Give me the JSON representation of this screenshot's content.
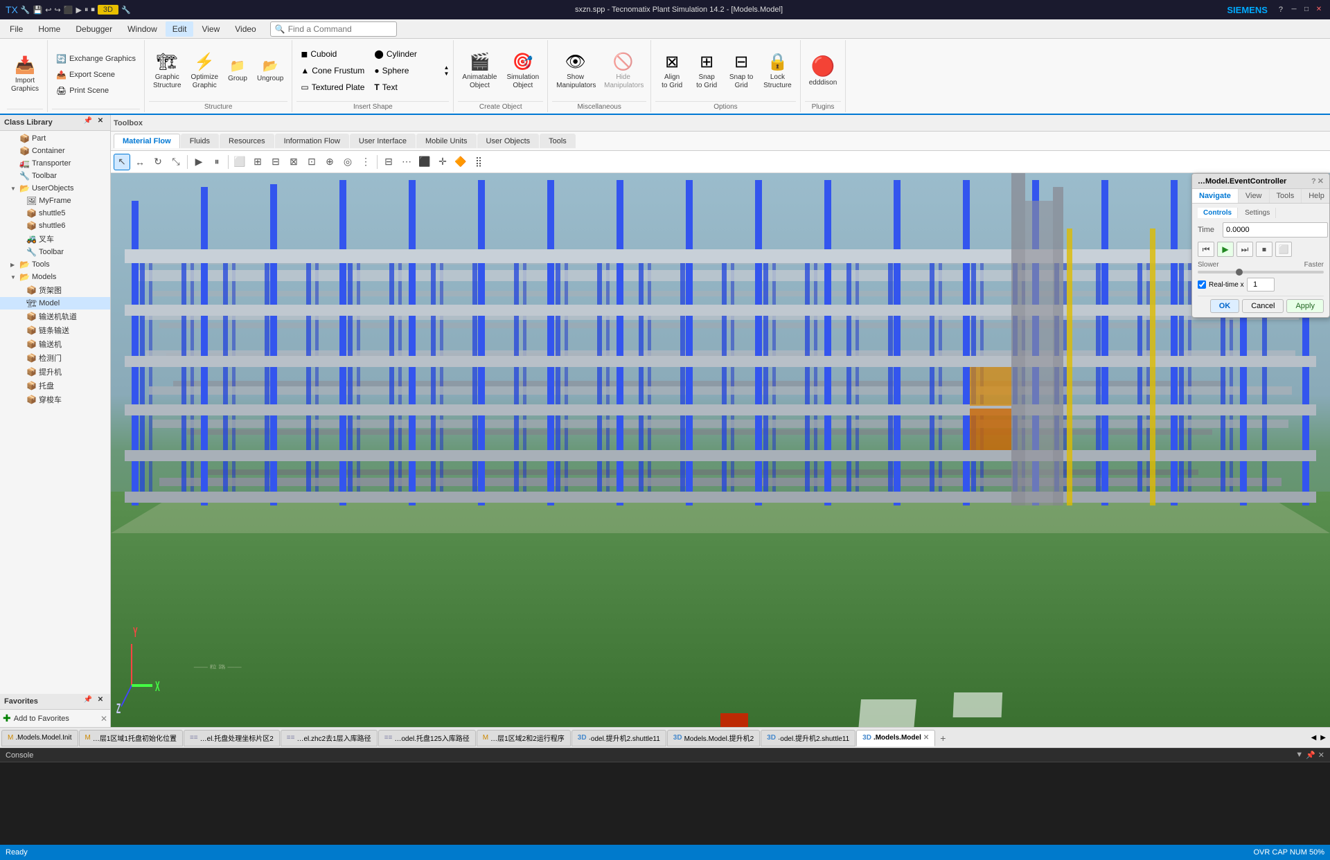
{
  "titlebar": {
    "title": "sxzn.spp - Tecnomatix Plant Simulation 14.2 - [Models.Model]",
    "siemens_label": "SIEMENS",
    "win_min": "─",
    "win_max": "□",
    "win_close": "✕"
  },
  "menubar": {
    "items": [
      {
        "id": "file",
        "label": "File"
      },
      {
        "id": "home",
        "label": "Home"
      },
      {
        "id": "debugger",
        "label": "Debugger"
      },
      {
        "id": "window",
        "label": "Window"
      },
      {
        "id": "edit",
        "label": "Edit"
      },
      {
        "id": "view",
        "label": "View"
      },
      {
        "id": "video",
        "label": "Video"
      }
    ],
    "search_placeholder": "Find a Command"
  },
  "ribbon": {
    "groups": [
      {
        "id": "import-graphics",
        "label": "Import\nGraphics",
        "icon": "📥",
        "sub_items": []
      },
      {
        "id": "exchange-graphics",
        "label": "Exchange Graphics",
        "sub_items": [
          {
            "label": "Exchange Graphics",
            "icon": "🔄"
          },
          {
            "label": "Export Scene",
            "icon": "📤"
          },
          {
            "label": "Print Scene",
            "icon": "🖨"
          }
        ]
      },
      {
        "id": "graphic-structure",
        "label": "Structure",
        "buttons": [
          {
            "id": "graphic-structure",
            "label": "Graphic\nStructure",
            "icon": "🏗"
          },
          {
            "id": "optimize-graphic",
            "label": "Optimize\nGraphic",
            "icon": "⚡"
          },
          {
            "id": "group",
            "label": "Group",
            "icon": "📁"
          },
          {
            "id": "ungroup",
            "label": "Ungroup",
            "icon": "📂"
          }
        ]
      },
      {
        "id": "insert-shape",
        "label": "Insert Shape",
        "items": [
          {
            "label": "Cuboid",
            "icon": "◼"
          },
          {
            "label": "Cylinder",
            "icon": "⬤"
          },
          {
            "label": "Cone Frustum",
            "icon": "▲"
          },
          {
            "label": "Sphere",
            "icon": "●"
          },
          {
            "label": "Textured Plate",
            "icon": "▭"
          },
          {
            "label": "Text",
            "icon": "T"
          }
        ]
      },
      {
        "id": "create-object",
        "label": "Create Object",
        "buttons": [
          {
            "id": "animatable-object",
            "label": "Animatable\nObject",
            "icon": "🎬"
          },
          {
            "id": "simulation-object",
            "label": "Simulation\nObject",
            "icon": "🎯"
          }
        ]
      },
      {
        "id": "miscellaneous",
        "label": "Miscellaneous",
        "buttons": [
          {
            "id": "show-manipulators",
            "label": "Show\nManipulators",
            "icon": "👁"
          },
          {
            "id": "hide-manipulators",
            "label": "Hide\nManipulators",
            "icon": "🚫"
          }
        ]
      },
      {
        "id": "options",
        "label": "Options",
        "buttons": [
          {
            "id": "snap-to-grid",
            "label": "Snap\nto Grid",
            "icon": "⊞"
          },
          {
            "id": "snap-to-grid2",
            "label": "Snap to\nGrid",
            "icon": "⊟"
          },
          {
            "id": "align-to-grid",
            "label": "Align\nto Grid",
            "icon": "⊠"
          },
          {
            "id": "lock-structure",
            "label": "Lock\nStructure",
            "icon": "🔒"
          }
        ]
      },
      {
        "id": "plugins",
        "label": "Plugins",
        "buttons": [
          {
            "id": "edddison",
            "label": "edddison",
            "icon": "🔴"
          }
        ]
      }
    ]
  },
  "left_panel": {
    "class_library_title": "Class Library",
    "favorites_title": "Favorites",
    "add_favorites_label": "Add to Favorites",
    "tree": [
      {
        "id": "part",
        "label": "Part",
        "level": 1,
        "icon": "📦",
        "expandable": false
      },
      {
        "id": "container",
        "label": "Container",
        "level": 1,
        "icon": "📦",
        "expandable": false
      },
      {
        "id": "transporter",
        "label": "Transporter",
        "level": 1,
        "icon": "🚛",
        "expandable": false
      },
      {
        "id": "toolbar",
        "label": "Toolbar",
        "level": 1,
        "icon": "🔧",
        "expandable": false
      },
      {
        "id": "userobjects",
        "label": "UserObjects",
        "level": 1,
        "icon": "📂",
        "expandable": true
      },
      {
        "id": "myframe",
        "label": "MyFrame",
        "level": 2,
        "icon": "🖼",
        "expandable": false
      },
      {
        "id": "shuttle5",
        "label": "shuttle5",
        "level": 2,
        "icon": "📦",
        "expandable": false
      },
      {
        "id": "shuttle6",
        "label": "shuttle6",
        "level": 2,
        "icon": "📦",
        "expandable": false
      },
      {
        "id": "forklift",
        "label": "叉车",
        "level": 2,
        "icon": "🚜",
        "expandable": false
      },
      {
        "id": "toolbar2",
        "label": "Toolbar",
        "level": 2,
        "icon": "🔧",
        "expandable": false
      },
      {
        "id": "tools",
        "label": "Tools",
        "level": 1,
        "icon": "📂",
        "expandable": true
      },
      {
        "id": "models",
        "label": "Models",
        "level": 1,
        "icon": "📂",
        "expandable": true
      },
      {
        "id": "shelf",
        "label": "货架图",
        "level": 2,
        "icon": "📦",
        "expandable": false
      },
      {
        "id": "model",
        "label": "Model",
        "level": 2,
        "icon": "🏗",
        "expandable": false
      },
      {
        "id": "conveyor1",
        "label": "输送机轨道",
        "level": 2,
        "icon": "📦",
        "expandable": false
      },
      {
        "id": "conveyor2",
        "label": "链条输送",
        "level": 2,
        "icon": "📦",
        "expandable": false
      },
      {
        "id": "conveyor3",
        "label": "输送机",
        "level": 2,
        "icon": "📦",
        "expandable": false
      },
      {
        "id": "detector",
        "label": "检测门",
        "level": 2,
        "icon": "📦",
        "expandable": false
      },
      {
        "id": "elevator",
        "label": "提升机",
        "level": 2,
        "icon": "📦",
        "expandable": false
      },
      {
        "id": "tray",
        "label": "托盘",
        "level": 2,
        "icon": "📦",
        "expandable": false
      },
      {
        "id": "shuttle_car",
        "label": "穿梭车",
        "level": 2,
        "icon": "📦",
        "expandable": false
      }
    ]
  },
  "toolbox": {
    "label": "Toolbox"
  },
  "tabs": [
    {
      "id": "material-flow",
      "label": "Material Flow",
      "active": true
    },
    {
      "id": "fluids",
      "label": "Fluids",
      "active": false
    },
    {
      "id": "resources",
      "label": "Resources",
      "active": false
    },
    {
      "id": "information-flow",
      "label": "Information Flow",
      "active": false
    },
    {
      "id": "user-interface",
      "label": "User Interface",
      "active": false
    },
    {
      "id": "mobile-units",
      "label": "Mobile Units",
      "active": false
    },
    {
      "id": "user-objects",
      "label": "User Objects",
      "active": false
    },
    {
      "id": "tools",
      "label": "Tools",
      "active": false
    }
  ],
  "bottom_tabs": [
    {
      "id": "init",
      "label": "M .Models.Model.Init",
      "closable": false
    },
    {
      "id": "tray-init",
      "label": "M …层1区域1托盘初始化位置",
      "closable": false
    },
    {
      "id": "tray-mgmt",
      "label": "≡≡…el.托盘处理坐标片区2",
      "closable": false
    },
    {
      "id": "zhc2",
      "label": "≡≡…el.zhc2去1层入库路径",
      "closable": false
    },
    {
      "id": "tray125",
      "label": "≡≡…odel.托盘125入库路径",
      "closable": false
    },
    {
      "id": "zone2-run",
      "label": "M …层1区域2和2运行程序",
      "closable": false
    },
    {
      "id": "3d-shuttle",
      "label": "3D ·odel.提升机2.shuttle11",
      "closable": false
    },
    {
      "id": "3d-model",
      "label": "3D Models.Model.提升机2",
      "closable": false
    },
    {
      "id": "3d-shuttle2",
      "label": "3D ·odel.提升机2.shuttle11",
      "closable": false
    },
    {
      "id": "3d-models-model",
      "label": "3D .Models.Model",
      "closable": true,
      "active": true
    }
  ],
  "console": {
    "label": "Console"
  },
  "status_bar": {
    "status": "Ready",
    "right_indicators": "OVR  CAP  NUM  50%"
  },
  "event_controller": {
    "title": "…Model.EventController",
    "tabs": [
      {
        "id": "navigate",
        "label": "Navigate"
      },
      {
        "id": "view",
        "label": "View"
      },
      {
        "id": "tools",
        "label": "Tools"
      },
      {
        "id": "help",
        "label": "Help"
      }
    ],
    "sections": [
      {
        "id": "controls",
        "label": "Controls"
      },
      {
        "id": "settings",
        "label": "Settings"
      }
    ],
    "time_label": "Time",
    "time_value": "0.0000",
    "speed_slower": "Slower",
    "speed_faster": "Faster",
    "realtime_label": "Real-time x",
    "realtime_value": "1",
    "buttons": {
      "ok": "OK",
      "cancel": "Cancel",
      "apply": "Apply"
    },
    "control_icons": [
      "⏮",
      "▶",
      "⏭",
      "⏹",
      "⬜"
    ]
  }
}
